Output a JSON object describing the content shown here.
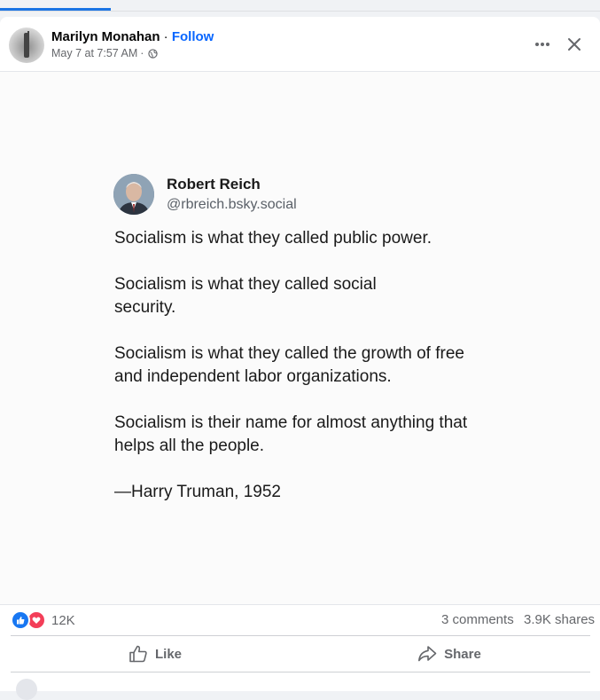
{
  "post": {
    "author": "Marilyn Monahan",
    "separator": " · ",
    "follow_label": "Follow",
    "timestamp": "May 7 at 7:57 AM",
    "meta_separator": " ·",
    "audience_icon": "globe-icon",
    "more_icon": "more-horizontal-icon",
    "close_icon": "close-icon"
  },
  "image": {
    "name": "Robert Reich",
    "handle": "@rbreich.bsky.social",
    "paragraphs": [
      "Socialism is what they called public power.",
      "Socialism is what they called social security.",
      "Socialism is what they called the growth of free and independent labor organizations.",
      "Socialism is their name for almost anything that helps all the people.",
      "—Harry Truman, 1952"
    ]
  },
  "stats": {
    "reaction_count": "12K",
    "comments": "3 comments",
    "shares": "3.9K shares"
  },
  "actions": {
    "like_label": "Like",
    "share_label": "Share"
  },
  "colors": {
    "accent": "#0866ff",
    "like_reaction": "#1877f2",
    "love_reaction": "#f33e58",
    "secondary_text": "#65676b"
  }
}
